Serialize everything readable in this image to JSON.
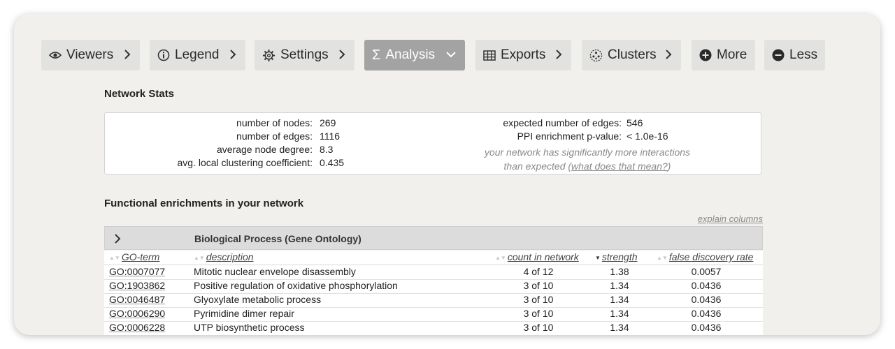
{
  "toolbar": {
    "buttons": [
      {
        "label": "Viewers",
        "icon": "eye-icon"
      },
      {
        "label": "Legend",
        "icon": "info-icon"
      },
      {
        "label": "Settings",
        "icon": "gear-icon"
      },
      {
        "label": "Analysis",
        "icon": "sigma-icon",
        "active": true
      },
      {
        "label": "Exports",
        "icon": "table-icon"
      },
      {
        "label": "Clusters",
        "icon": "clusters-icon"
      },
      {
        "label": "More",
        "icon": "plus-circle-icon"
      },
      {
        "label": "Less",
        "icon": "minus-circle-icon"
      }
    ],
    "active_color": "#a3a3a3"
  },
  "network_stats": {
    "title": "Network Stats",
    "nodes_label": "number of nodes:",
    "nodes_value": "269",
    "edges_label": "number of edges:",
    "edges_value": "1116",
    "degree_label": "average node degree:",
    "degree_value": "8.3",
    "clustering_label": "avg. local clustering coefficient:",
    "clustering_value": "0.435",
    "expected_label": "expected number of edges:",
    "expected_value": "546",
    "ppi_label": "PPI enrichment p-value:",
    "ppi_value": "< 1.0e-16",
    "note_line1": "your network has significantly more interactions",
    "note_line2_prefix": "than expected (",
    "note_link": "what does that mean?",
    "note_line2_suffix": ")"
  },
  "enrichment": {
    "title": "Functional enrichments in your network",
    "explain_link": "explain columns",
    "category_title": "Biological Process (Gene Ontology)",
    "columns": {
      "go_term": "GO-term",
      "description": "description",
      "count": "count in network",
      "strength": "strength",
      "fdr": "false discovery rate"
    },
    "rows": [
      {
        "go": "GO:0007077",
        "desc": "Mitotic nuclear envelope disassembly",
        "count": "4 of 12",
        "strength": "1.38",
        "fdr": "0.0057"
      },
      {
        "go": "GO:1903862",
        "desc": "Positive regulation of oxidative phosphorylation",
        "count": "3 of 10",
        "strength": "1.34",
        "fdr": "0.0436"
      },
      {
        "go": "GO:0046487",
        "desc": "Glyoxylate metabolic process",
        "count": "3 of 10",
        "strength": "1.34",
        "fdr": "0.0436"
      },
      {
        "go": "GO:0006290",
        "desc": "Pyrimidine dimer repair",
        "count": "3 of 10",
        "strength": "1.34",
        "fdr": "0.0436"
      },
      {
        "go": "GO:0006228",
        "desc": "UTP biosynthetic process",
        "count": "3 of 10",
        "strength": "1.34",
        "fdr": "0.0436"
      }
    ]
  }
}
